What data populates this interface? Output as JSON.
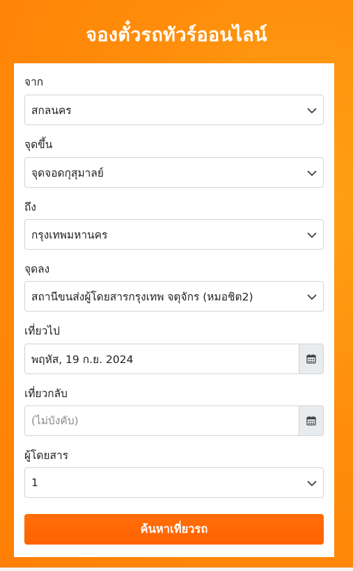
{
  "header": {
    "title": "จองตั๋วรถทัวร์ออนไลน์"
  },
  "form": {
    "from": {
      "label": "จาก",
      "value": "สกลนคร"
    },
    "pickup": {
      "label": "จุดขึ้น",
      "value": "จุดจอดกุสุมาลย์"
    },
    "to": {
      "label": "ถึง",
      "value": "กรุงเทพมหานคร"
    },
    "dropoff": {
      "label": "จุดลง",
      "value": "สถานีขนส่งผู้โดยสารกรุงเทพ จตุจักร (หมอชิต2)"
    },
    "depart": {
      "label": "เที่ยวไป",
      "value": "พฤหัส, 19 ก.ย. 2024"
    },
    "return": {
      "label": "เที่ยวกลับ",
      "placeholder": "(ไม่บังคับ)"
    },
    "passengers": {
      "label": "ผู้โดยสาร",
      "value": "1"
    },
    "submit_label": "ค้นหาเที่ยวรถ"
  },
  "colors": {
    "brand_orange": "#ff8d0b",
    "button_orange": "#ff6600"
  },
  "icons": {
    "select_arrow": "chevron-down-icon",
    "calendar": "calendar-icon"
  }
}
